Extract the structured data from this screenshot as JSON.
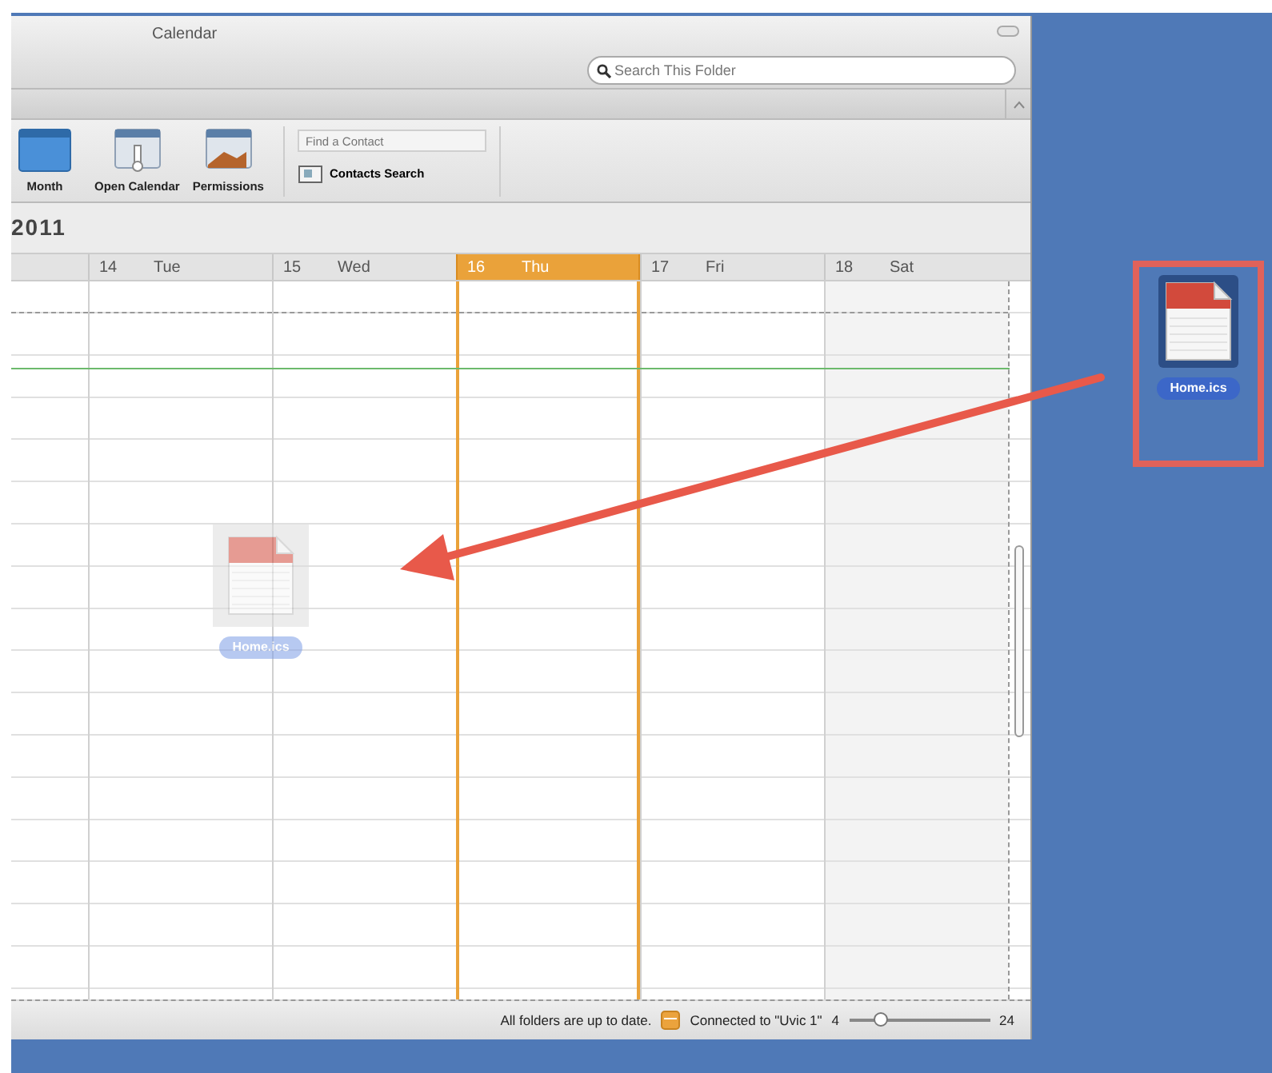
{
  "window": {
    "title": "Calendar"
  },
  "search": {
    "placeholder": "Search This Folder"
  },
  "ribbon": {
    "buttons": [
      {
        "label": "Month",
        "kind": "month"
      },
      {
        "label": "Open Calendar",
        "kind": "open"
      },
      {
        "label": "Permissions",
        "kind": "permissions"
      }
    ],
    "contact_search": {
      "placeholder": "Find a Contact",
      "button": "Contacts Search"
    }
  },
  "year_heading": "2011",
  "days": [
    {
      "number": "14",
      "name": "Tue",
      "selected": false
    },
    {
      "number": "15",
      "name": "Wed",
      "selected": false
    },
    {
      "number": "16",
      "name": "Thu",
      "selected": true
    },
    {
      "number": "17",
      "name": "Fri",
      "selected": false
    },
    {
      "number": "18",
      "name": "Sat",
      "selected": false
    }
  ],
  "dragged_file": {
    "label": "Home.ics"
  },
  "status_bar": {
    "sync": "All folders are up to date.",
    "connection": "Connected to \"Uvic 1\"",
    "zoom_min": "4",
    "zoom_max": "24",
    "zoom": {
      "level": 0.22
    }
  },
  "desktop_file": {
    "label": "Home.ics",
    "selected": true
  }
}
